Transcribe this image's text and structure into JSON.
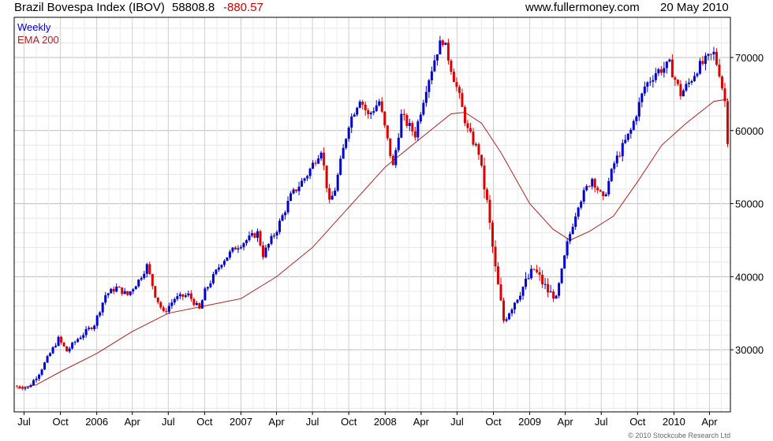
{
  "header": {
    "title": "Brazil Bovespa Index (IBOV)",
    "last": "58808.8",
    "change": "-880.57",
    "site": "www.fullermoney.com",
    "date": "20 May 2010"
  },
  "colors": {
    "up": "#0000cc",
    "down": "#dd0000",
    "ema": "#aa2222",
    "grid": "#cccccc",
    "frame": "#000000"
  },
  "chart_data": {
    "type": "candlestick",
    "legend": [
      "Weekly",
      "EMA 200"
    ],
    "ylim": [
      21500,
      75500
    ],
    "yticks": [
      30000,
      40000,
      50000,
      60000,
      70000
    ],
    "ytick_labels": [
      "30000",
      "40000",
      "50000",
      "60000",
      "70000"
    ],
    "x_range": [
      "2005-06-06",
      "2010-05-24"
    ],
    "xticks": [
      {
        "label": "Jul",
        "date": "2005-07-01"
      },
      {
        "label": "Oct",
        "date": "2005-10-01"
      },
      {
        "label": "2006",
        "date": "2006-01-01"
      },
      {
        "label": "Apr",
        "date": "2006-04-01"
      },
      {
        "label": "Jul",
        "date": "2006-07-01"
      },
      {
        "label": "Oct",
        "date": "2006-10-01"
      },
      {
        "label": "2007",
        "date": "2007-01-01"
      },
      {
        "label": "Apr",
        "date": "2007-04-01"
      },
      {
        "label": "Jul",
        "date": "2007-07-01"
      },
      {
        "label": "Oct",
        "date": "2007-10-01"
      },
      {
        "label": "2008",
        "date": "2008-01-01"
      },
      {
        "label": "Apr",
        "date": "2008-04-01"
      },
      {
        "label": "Jul",
        "date": "2008-07-01"
      },
      {
        "label": "Oct",
        "date": "2008-10-01"
      },
      {
        "label": "2009",
        "date": "2009-01-01"
      },
      {
        "label": "Apr",
        "date": "2009-04-01"
      },
      {
        "label": "Jul",
        "date": "2009-07-01"
      },
      {
        "label": "Oct",
        "date": "2009-10-01"
      },
      {
        "label": "2010",
        "date": "2010-01-01"
      },
      {
        "label": "Apr",
        "date": "2010-04-01"
      }
    ],
    "close_path": [
      [
        "2005-06-13",
        25000
      ],
      [
        "2005-07-11",
        24800
      ],
      [
        "2005-08-08",
        26800
      ],
      [
        "2005-09-05",
        29500
      ],
      [
        "2005-09-26",
        31500
      ],
      [
        "2005-10-17",
        29800
      ],
      [
        "2005-11-14",
        31500
      ],
      [
        "2005-12-26",
        33500
      ],
      [
        "2006-01-23",
        37500
      ],
      [
        "2006-02-20",
        38500
      ],
      [
        "2006-03-20",
        37500
      ],
      [
        "2006-04-17",
        39500
      ],
      [
        "2006-05-08",
        41500
      ],
      [
        "2006-05-29",
        37500
      ],
      [
        "2006-06-19",
        35000
      ],
      [
        "2006-07-17",
        37000
      ],
      [
        "2006-08-21",
        37500
      ],
      [
        "2006-09-18",
        35500
      ],
      [
        "2006-10-02",
        38000
      ],
      [
        "2006-11-13",
        42000
      ],
      [
        "2006-12-18",
        44000
      ],
      [
        "2007-01-15",
        45000
      ],
      [
        "2007-02-12",
        46000
      ],
      [
        "2007-02-26",
        43000
      ],
      [
        "2007-04-02",
        46500
      ],
      [
        "2007-05-07",
        51000
      ],
      [
        "2007-06-18",
        54000
      ],
      [
        "2007-07-23",
        57500
      ],
      [
        "2007-08-13",
        50000
      ],
      [
        "2007-08-27",
        52000
      ],
      [
        "2007-10-01",
        61000
      ],
      [
        "2007-10-29",
        64500
      ],
      [
        "2007-11-19",
        62000
      ],
      [
        "2007-12-17",
        64000
      ],
      [
        "2008-01-21",
        55000
      ],
      [
        "2008-02-11",
        62000
      ],
      [
        "2008-03-17",
        59500
      ],
      [
        "2008-04-14",
        66000
      ],
      [
        "2008-05-12",
        71000
      ],
      [
        "2008-05-26",
        72500
      ],
      [
        "2008-06-09",
        70000
      ],
      [
        "2008-07-07",
        64500
      ],
      [
        "2008-07-28",
        60000
      ],
      [
        "2008-08-25",
        57000
      ],
      [
        "2008-09-15",
        50000
      ],
      [
        "2008-10-06",
        41000
      ],
      [
        "2008-10-27",
        34000
      ],
      [
        "2008-11-17",
        36000
      ],
      [
        "2008-12-08",
        38000
      ],
      [
        "2009-01-12",
        41000
      ],
      [
        "2009-02-16",
        38000
      ],
      [
        "2009-03-09",
        37000
      ],
      [
        "2009-04-06",
        44500
      ],
      [
        "2009-05-04",
        50000
      ],
      [
        "2009-06-08",
        53500
      ],
      [
        "2009-07-06",
        50500
      ],
      [
        "2009-08-03",
        55500
      ],
      [
        "2009-09-14",
        60000
      ],
      [
        "2009-10-19",
        66000
      ],
      [
        "2009-11-16",
        68000
      ],
      [
        "2009-12-21",
        69000
      ],
      [
        "2010-01-18",
        65000
      ],
      [
        "2010-02-08",
        66500
      ],
      [
        "2010-03-01",
        68500
      ],
      [
        "2010-04-12",
        70500
      ],
      [
        "2010-04-26",
        68000
      ],
      [
        "2010-05-10",
        64000
      ],
      [
        "2010-05-17",
        58800
      ]
    ],
    "ema200": [
      [
        "2005-06-13",
        24700
      ],
      [
        "2005-08-01",
        25200
      ],
      [
        "2005-10-01",
        27000
      ],
      [
        "2006-01-01",
        29500
      ],
      [
        "2006-04-01",
        32500
      ],
      [
        "2006-07-01",
        35000
      ],
      [
        "2006-10-01",
        36000
      ],
      [
        "2007-01-01",
        37000
      ],
      [
        "2007-04-01",
        40000
      ],
      [
        "2007-07-01",
        44000
      ],
      [
        "2007-10-01",
        49500
      ],
      [
        "2008-01-01",
        55000
      ],
      [
        "2008-04-01",
        59000
      ],
      [
        "2008-06-16",
        62300
      ],
      [
        "2008-07-21",
        62500
      ],
      [
        "2008-09-01",
        61000
      ],
      [
        "2008-10-20",
        57000
      ],
      [
        "2009-01-01",
        50000
      ],
      [
        "2009-03-01",
        46500
      ],
      [
        "2009-04-13",
        45000
      ],
      [
        "2009-06-01",
        46200
      ],
      [
        "2009-08-01",
        48300
      ],
      [
        "2009-10-01",
        53000
      ],
      [
        "2009-12-01",
        58000
      ],
      [
        "2010-02-01",
        61000
      ],
      [
        "2010-04-12",
        64000
      ],
      [
        "2010-05-17",
        64300
      ]
    ]
  },
  "footer": {
    "credit": "© 2010 Stockcube Research Ltd"
  }
}
